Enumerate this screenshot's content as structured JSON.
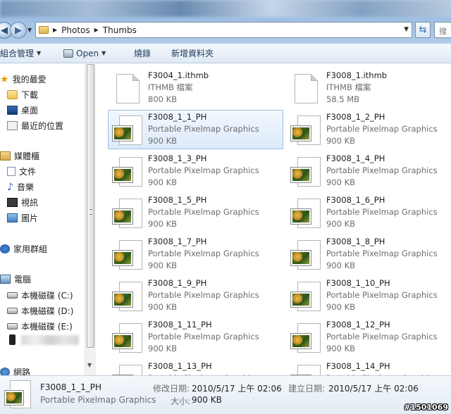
{
  "address": {
    "crumbs": [
      "Photos",
      "Thumbs"
    ],
    "search_placeholder": "搜"
  },
  "toolbar": {
    "organize": "組合管理",
    "open": "Open",
    "burn": "燒錄",
    "new_folder": "新增資料夾"
  },
  "sidebar": {
    "items": [
      {
        "label": "我的最愛",
        "icon": "star-icon"
      },
      {
        "label": "下載",
        "icon": "downloads-folder-icon"
      },
      {
        "label": "桌面",
        "icon": "desktop-icon"
      },
      {
        "label": "最近的位置",
        "icon": "recent-places-icon"
      },
      {
        "label": "媒體櫃",
        "icon": "libraries-icon"
      },
      {
        "label": "文件",
        "icon": "documents-icon"
      },
      {
        "label": "音樂",
        "icon": "music-icon"
      },
      {
        "label": "視訊",
        "icon": "video-icon"
      },
      {
        "label": "圖片",
        "icon": "pictures-icon"
      },
      {
        "label": "家用群組",
        "icon": "homegroup-icon"
      },
      {
        "label": "電腦",
        "icon": "computer-icon"
      },
      {
        "label": "本機磁碟 (C:)",
        "icon": "drive-icon"
      },
      {
        "label": "本機磁碟 (D:)",
        "icon": "drive-icon"
      },
      {
        "label": "本機磁碟 (E:)",
        "icon": "drive-icon"
      },
      {
        "label": "",
        "icon": "phone-icon"
      },
      {
        "label": "網路",
        "icon": "network-icon"
      }
    ]
  },
  "files": [
    {
      "name": "F3004_1.ithmb",
      "type": "ITHMB 檔案",
      "size": "800 KB",
      "icon": "blank-file-icon"
    },
    {
      "name": "F3008_1.ithmb",
      "type": "ITHMB 檔案",
      "size": "58.5 MB",
      "icon": "blank-file-icon"
    },
    {
      "name": "F3008_1_1_PH",
      "type": "Portable Pixelmap Graphics",
      "size": "900 KB",
      "icon": "image-file-icon",
      "selected": true
    },
    {
      "name": "F3008_1_2_PH",
      "type": "Portable Pixelmap Graphics",
      "size": "900 KB",
      "icon": "image-file-icon"
    },
    {
      "name": "F3008_1_3_PH",
      "type": "Portable Pixelmap Graphics",
      "size": "900 KB",
      "icon": "image-file-icon"
    },
    {
      "name": "F3008_1_4_PH",
      "type": "Portable Pixelmap Graphics",
      "size": "900 KB",
      "icon": "image-file-icon"
    },
    {
      "name": "F3008_1_5_PH",
      "type": "Portable Pixelmap Graphics",
      "size": "900 KB",
      "icon": "image-file-icon"
    },
    {
      "name": "F3008_1_6_PH",
      "type": "Portable Pixelmap Graphics",
      "size": "900 KB",
      "icon": "image-file-icon"
    },
    {
      "name": "F3008_1_7_PH",
      "type": "Portable Pixelmap Graphics",
      "size": "900 KB",
      "icon": "image-file-icon"
    },
    {
      "name": "F3008_1_8_PH",
      "type": "Portable Pixelmap Graphics",
      "size": "900 KB",
      "icon": "image-file-icon"
    },
    {
      "name": "F3008_1_9_PH",
      "type": "Portable Pixelmap Graphics",
      "size": "900 KB",
      "icon": "image-file-icon"
    },
    {
      "name": "F3008_1_10_PH",
      "type": "Portable Pixelmap Graphics",
      "size": "900 KB",
      "icon": "image-file-icon"
    },
    {
      "name": "F3008_1_11_PH",
      "type": "Portable Pixelmap Graphics",
      "size": "900 KB",
      "icon": "image-file-icon"
    },
    {
      "name": "F3008_1_12_PH",
      "type": "Portable Pixelmap Graphics",
      "size": "900 KB",
      "icon": "image-file-icon"
    },
    {
      "name": "F3008_1_13_PH",
      "type": "Portable Pixelmap Graphics",
      "size": "",
      "icon": "image-file-icon"
    },
    {
      "name": "F3008_1_14_PH",
      "type": "Portable Pixelmap Graphics",
      "size": "",
      "icon": "image-file-icon"
    }
  ],
  "details": {
    "name": "F3008_1_1_PH",
    "type": "Portable Pixelmap Graphics",
    "modified_label": "修改日期:",
    "modified_value": "2010/5/17 上午 02:06",
    "created_label": "建立日期:",
    "created_value": "2010/5/17 上午 02:06",
    "size_label": "大小:",
    "size_value": "900 KB"
  },
  "watermark": "#1501069",
  "colors": {
    "selection_fill": "#dceafa",
    "selection_border": "#9dc0e6",
    "secondary_text": "#6d6d6d",
    "toolbar_text": "#1e395b"
  }
}
